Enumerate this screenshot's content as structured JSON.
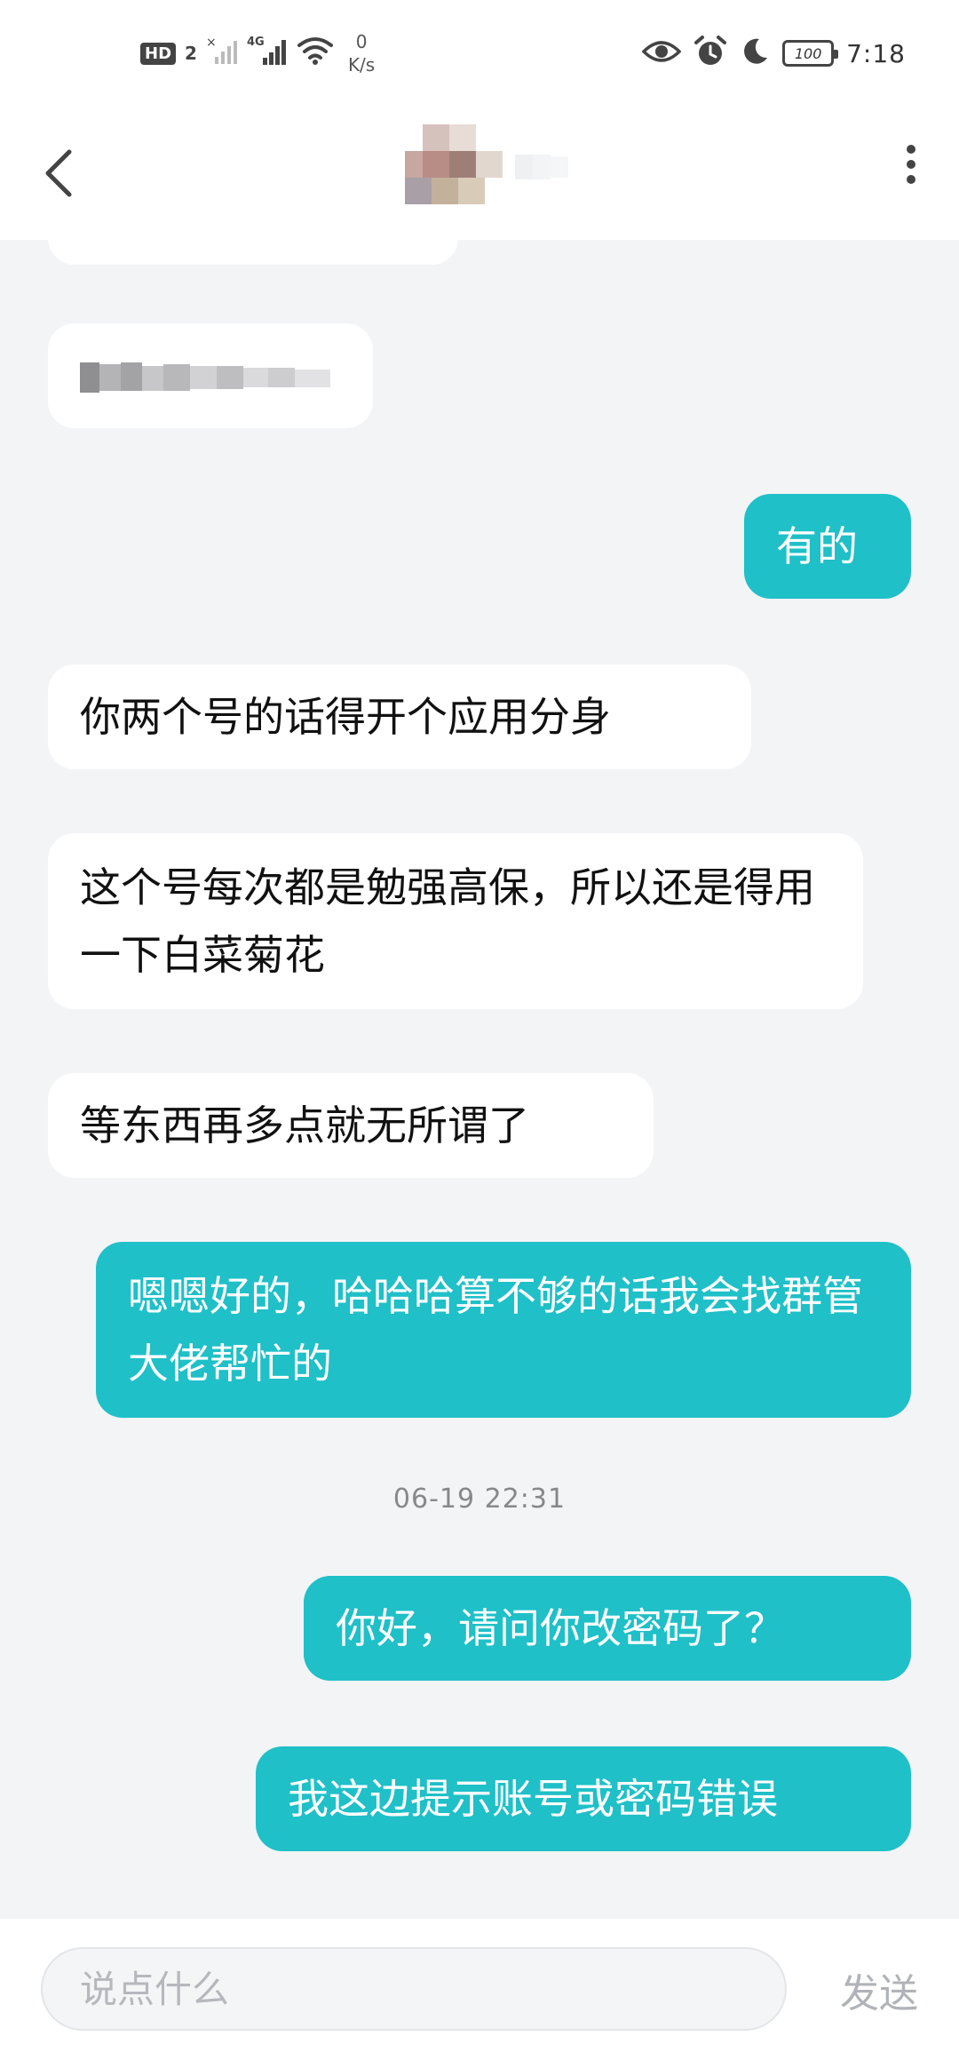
{
  "status_bar": {
    "hd_badge": "HD",
    "sim_number": "2",
    "network_type": "4G",
    "net_speed_value": "0",
    "net_speed_unit": "K/s",
    "battery_level": "100",
    "clock": "7:18"
  },
  "messages": [
    {
      "side": "in",
      "text": ""
    },
    {
      "side": "in",
      "text": ""
    },
    {
      "side": "out",
      "text": "有的"
    },
    {
      "side": "in",
      "text": "你两个号的话得开个应用分身"
    },
    {
      "side": "in",
      "text": "这个号每次都是勉强高保，所以还是得用一下白菜菊花"
    },
    {
      "side": "in",
      "text": "等东西再多点就无所谓了"
    },
    {
      "side": "out",
      "text": "嗯嗯好的，哈哈哈算不够的话我会找群管大佬帮忙的"
    },
    {
      "side": "out",
      "text": "你好，请问你改密码了？"
    },
    {
      "side": "out",
      "text": "我这边提示账号或密码错误"
    }
  ],
  "timestamp": "06-19 22:31",
  "input": {
    "placeholder": "说点什么",
    "send_label": "发送"
  },
  "colors": {
    "outgoing_bubble": "#1fc0c8",
    "incoming_bubble": "#ffffff",
    "background": "#f3f4f6"
  },
  "icons": [
    "back-arrow-icon",
    "more-vertical-icon",
    "eye-icon",
    "alarm-icon",
    "moon-icon",
    "wifi-icon",
    "signal-icon",
    "battery-icon"
  ]
}
